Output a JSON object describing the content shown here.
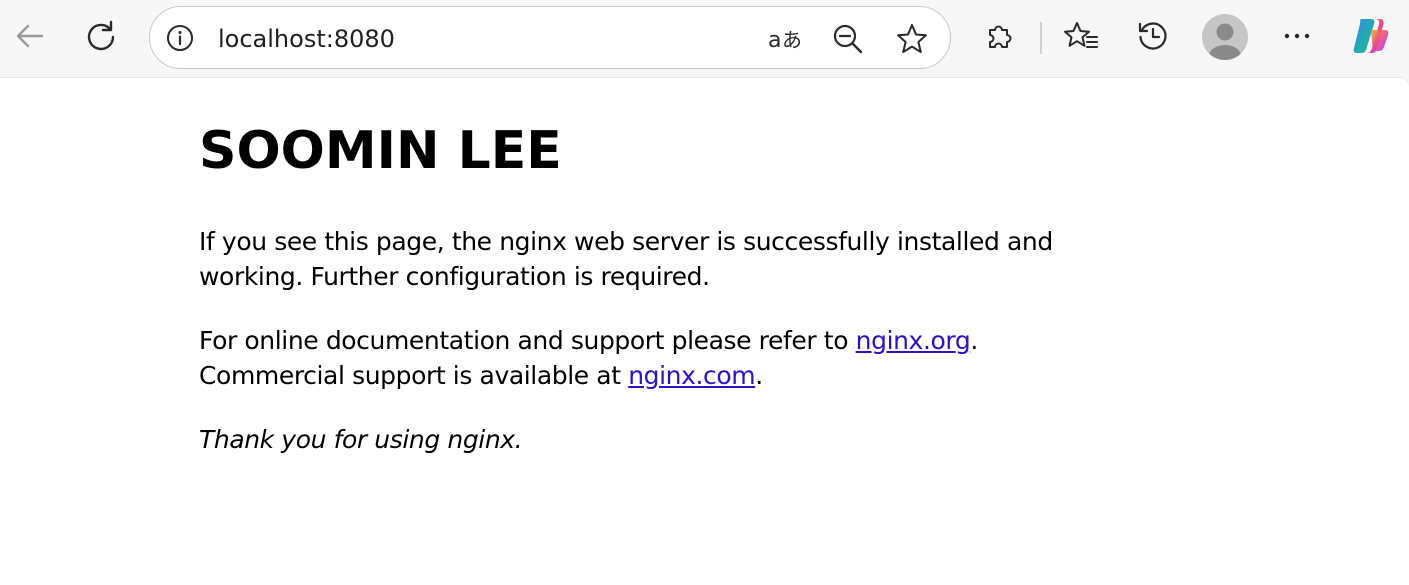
{
  "browser": {
    "url": "localhost:8080",
    "toolbar_icons": [
      "back-arrow-icon",
      "refresh-icon",
      "info-icon",
      "read-aloud-translate-icon",
      "zoom-out-icon",
      "favorite-star-icon",
      "extensions-icon",
      "favorites-icon",
      "history-icon",
      "profile-avatar-icon",
      "more-icon",
      "copilot-icon"
    ]
  },
  "page": {
    "heading": "SOOMIN LEE",
    "para1": "If you see this page, the nginx web server is successfully installed and working. Further configuration is required.",
    "para2_prefix": "For online documentation and support please refer to ",
    "link_org": "nginx.org",
    "para2_mid": ".",
    "para2_line2_prefix": "Commercial support is available at ",
    "link_com": "nginx.com",
    "para2_end": ".",
    "thanks": "Thank you for using nginx."
  },
  "colors": {
    "link": "#2a12c8",
    "toolbar_bg": "#f7f7f7",
    "page_bg": "#ffffff"
  }
}
